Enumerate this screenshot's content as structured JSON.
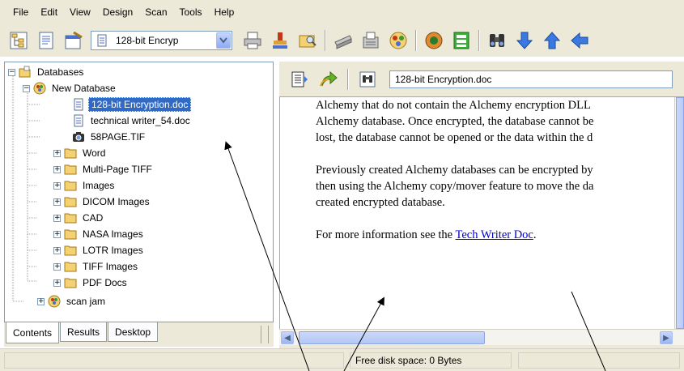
{
  "menu": [
    "File",
    "Edit",
    "View",
    "Design",
    "Scan",
    "Tools",
    "Help"
  ],
  "toolbar": {
    "combo_value": "128-bit Encryp",
    "icons": [
      "tree-view-icon",
      "document-view-icon",
      "properties-icon",
      "print-icon",
      "stamp-icon",
      "find-file-icon",
      "scanner-icon",
      "fax-icon",
      "convert-icon",
      "globe-icon",
      "film-strip-icon",
      "binoculars-icon",
      "arrow-down-icon",
      "arrow-up-icon",
      "arrow-left-icon"
    ]
  },
  "tree": {
    "root": "Databases",
    "database": "New Database",
    "items": [
      {
        "label": "128-bit Encryption.doc",
        "selected": true
      },
      {
        "label": "technical writer_54.doc"
      },
      {
        "label": "58PAGE.TIF"
      },
      {
        "label": "Word"
      },
      {
        "label": "Multi-Page TIFF"
      },
      {
        "label": "Images"
      },
      {
        "label": "DICOM Images"
      },
      {
        "label": "CAD"
      },
      {
        "label": "NASA Images"
      },
      {
        "label": "LOTR Images"
      },
      {
        "label": "TIFF Images"
      },
      {
        "label": "PDF Docs"
      }
    ],
    "other_database": "scan jam"
  },
  "tabs": [
    "Contents",
    "Results",
    "Desktop"
  ],
  "document": {
    "name": "128-bit Encryption.doc",
    "para1": [
      "Alchemy that do not contain the Alchemy encryption DLL",
      "Alchemy database. Once encrypted, the database cannot be",
      "lost, the database cannot be opened or the data within the d"
    ],
    "para2": [
      "Previously created Alchemy databases can be encrypted by",
      "then using the Alchemy copy/mover feature to move the da",
      "created encrypted database."
    ],
    "para3_prefix": "For more information see the ",
    "para3_link": "Tech Writer Doc",
    "para3_suffix": "."
  },
  "status": {
    "free_space": "Free disk space: 0 Bytes"
  },
  "colors": {
    "chrome": "#ece9d8",
    "selection": "#316ac5",
    "link": "#0000cc",
    "folder": "#f5d271"
  }
}
